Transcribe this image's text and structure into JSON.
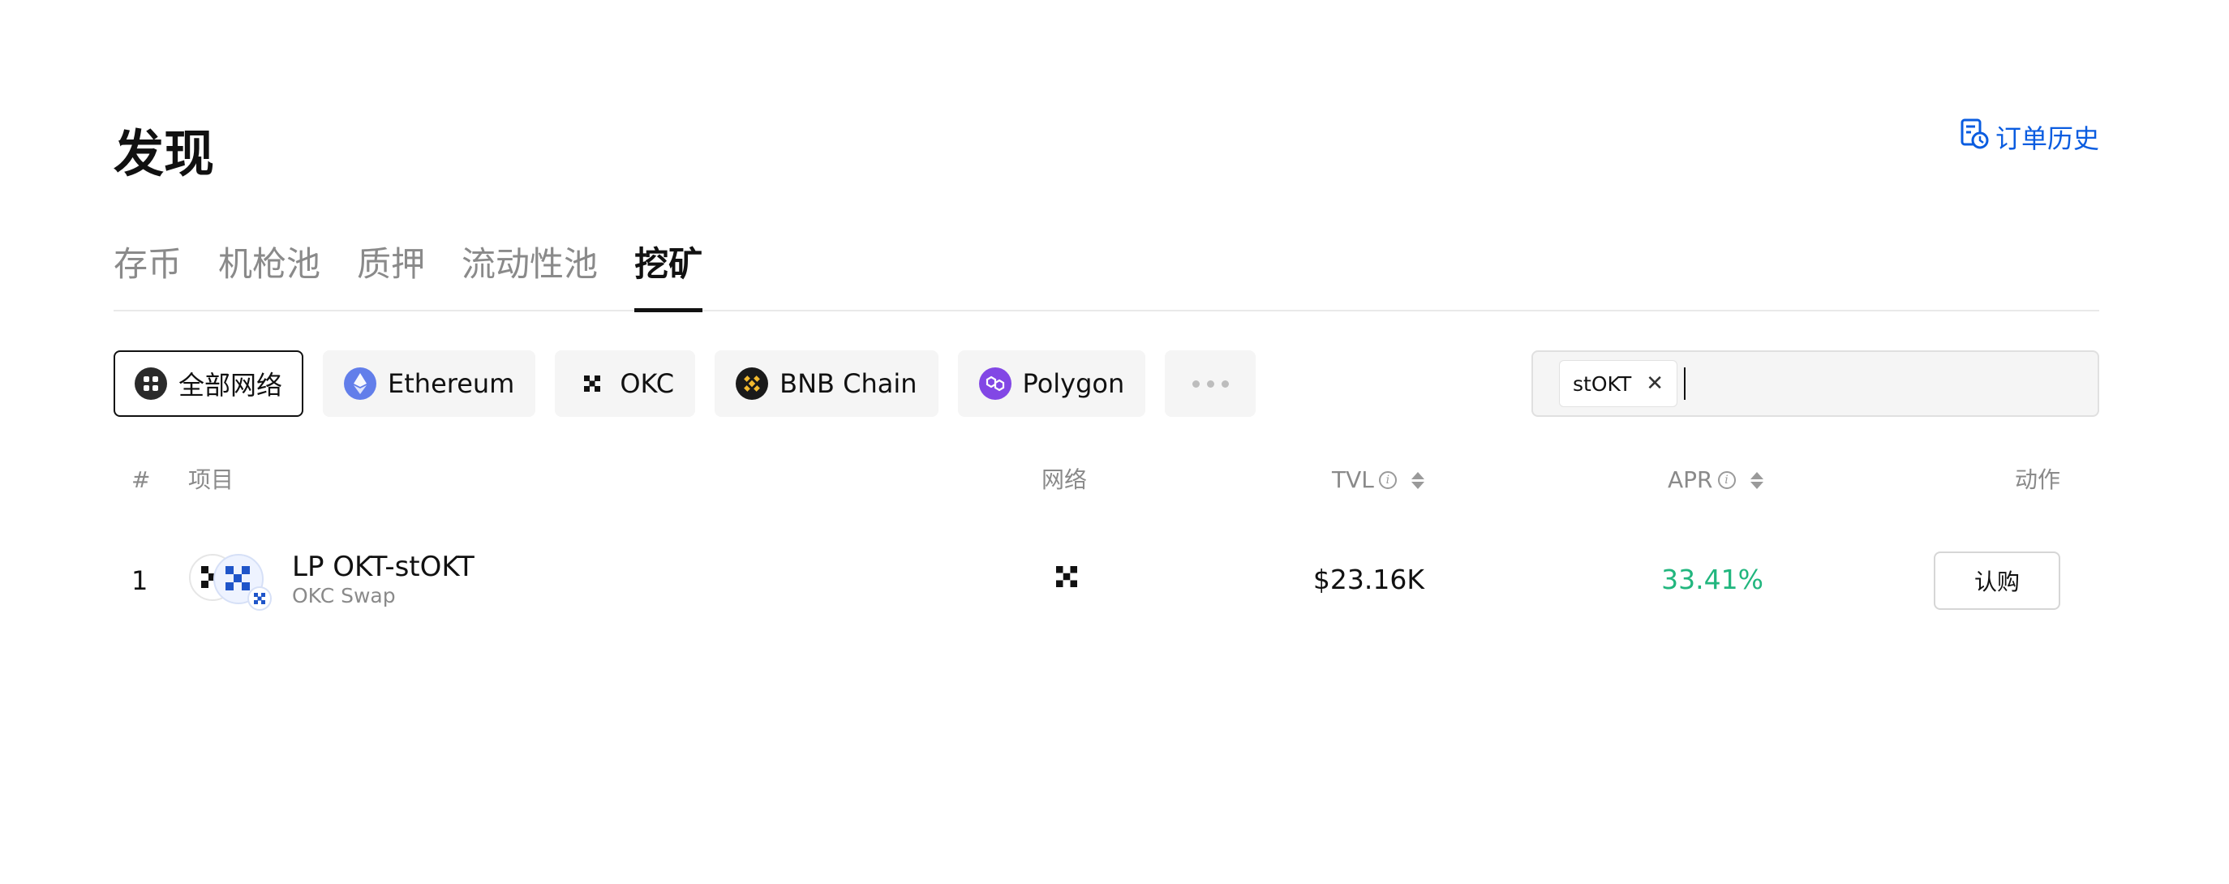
{
  "header": {
    "title": "发现",
    "order_history_label": "订单历史",
    "order_history_icon": "order-history-icon"
  },
  "tabs": [
    {
      "label": "存币",
      "active": false
    },
    {
      "label": "机枪池",
      "active": false
    },
    {
      "label": "质押",
      "active": false
    },
    {
      "label": "流动性池",
      "active": false
    },
    {
      "label": "挖矿",
      "active": true
    }
  ],
  "networks": [
    {
      "label": "全部网络",
      "icon": "all-networks-icon",
      "active": true
    },
    {
      "label": "Ethereum",
      "icon": "ethereum-icon",
      "active": false
    },
    {
      "label": "OKC",
      "icon": "okc-icon",
      "active": false
    },
    {
      "label": "BNB Chain",
      "icon": "bnb-icon",
      "active": false
    },
    {
      "label": "Polygon",
      "icon": "polygon-icon",
      "active": false
    }
  ],
  "more_icon": "more-dots-icon",
  "search": {
    "token_tag": "stOKT",
    "value": "",
    "placeholder": ""
  },
  "table": {
    "headers": {
      "index": "#",
      "project": "项目",
      "network": "网络",
      "tvl": "TVL",
      "apr": "APR",
      "action": "动作"
    },
    "rows": [
      {
        "index": "1",
        "name": "LP OKT-stOKT",
        "sub": "OKC Swap",
        "network_icon": "okc-icon",
        "tvl": "$23.16K",
        "apr": "33.41%",
        "action": "认购"
      }
    ]
  },
  "colors": {
    "accent_blue": "#0a5ce0",
    "apr_green": "#21b67e",
    "ethereum": "#627eea",
    "bnb": "#f3ba2f",
    "polygon": "#8247e5"
  }
}
